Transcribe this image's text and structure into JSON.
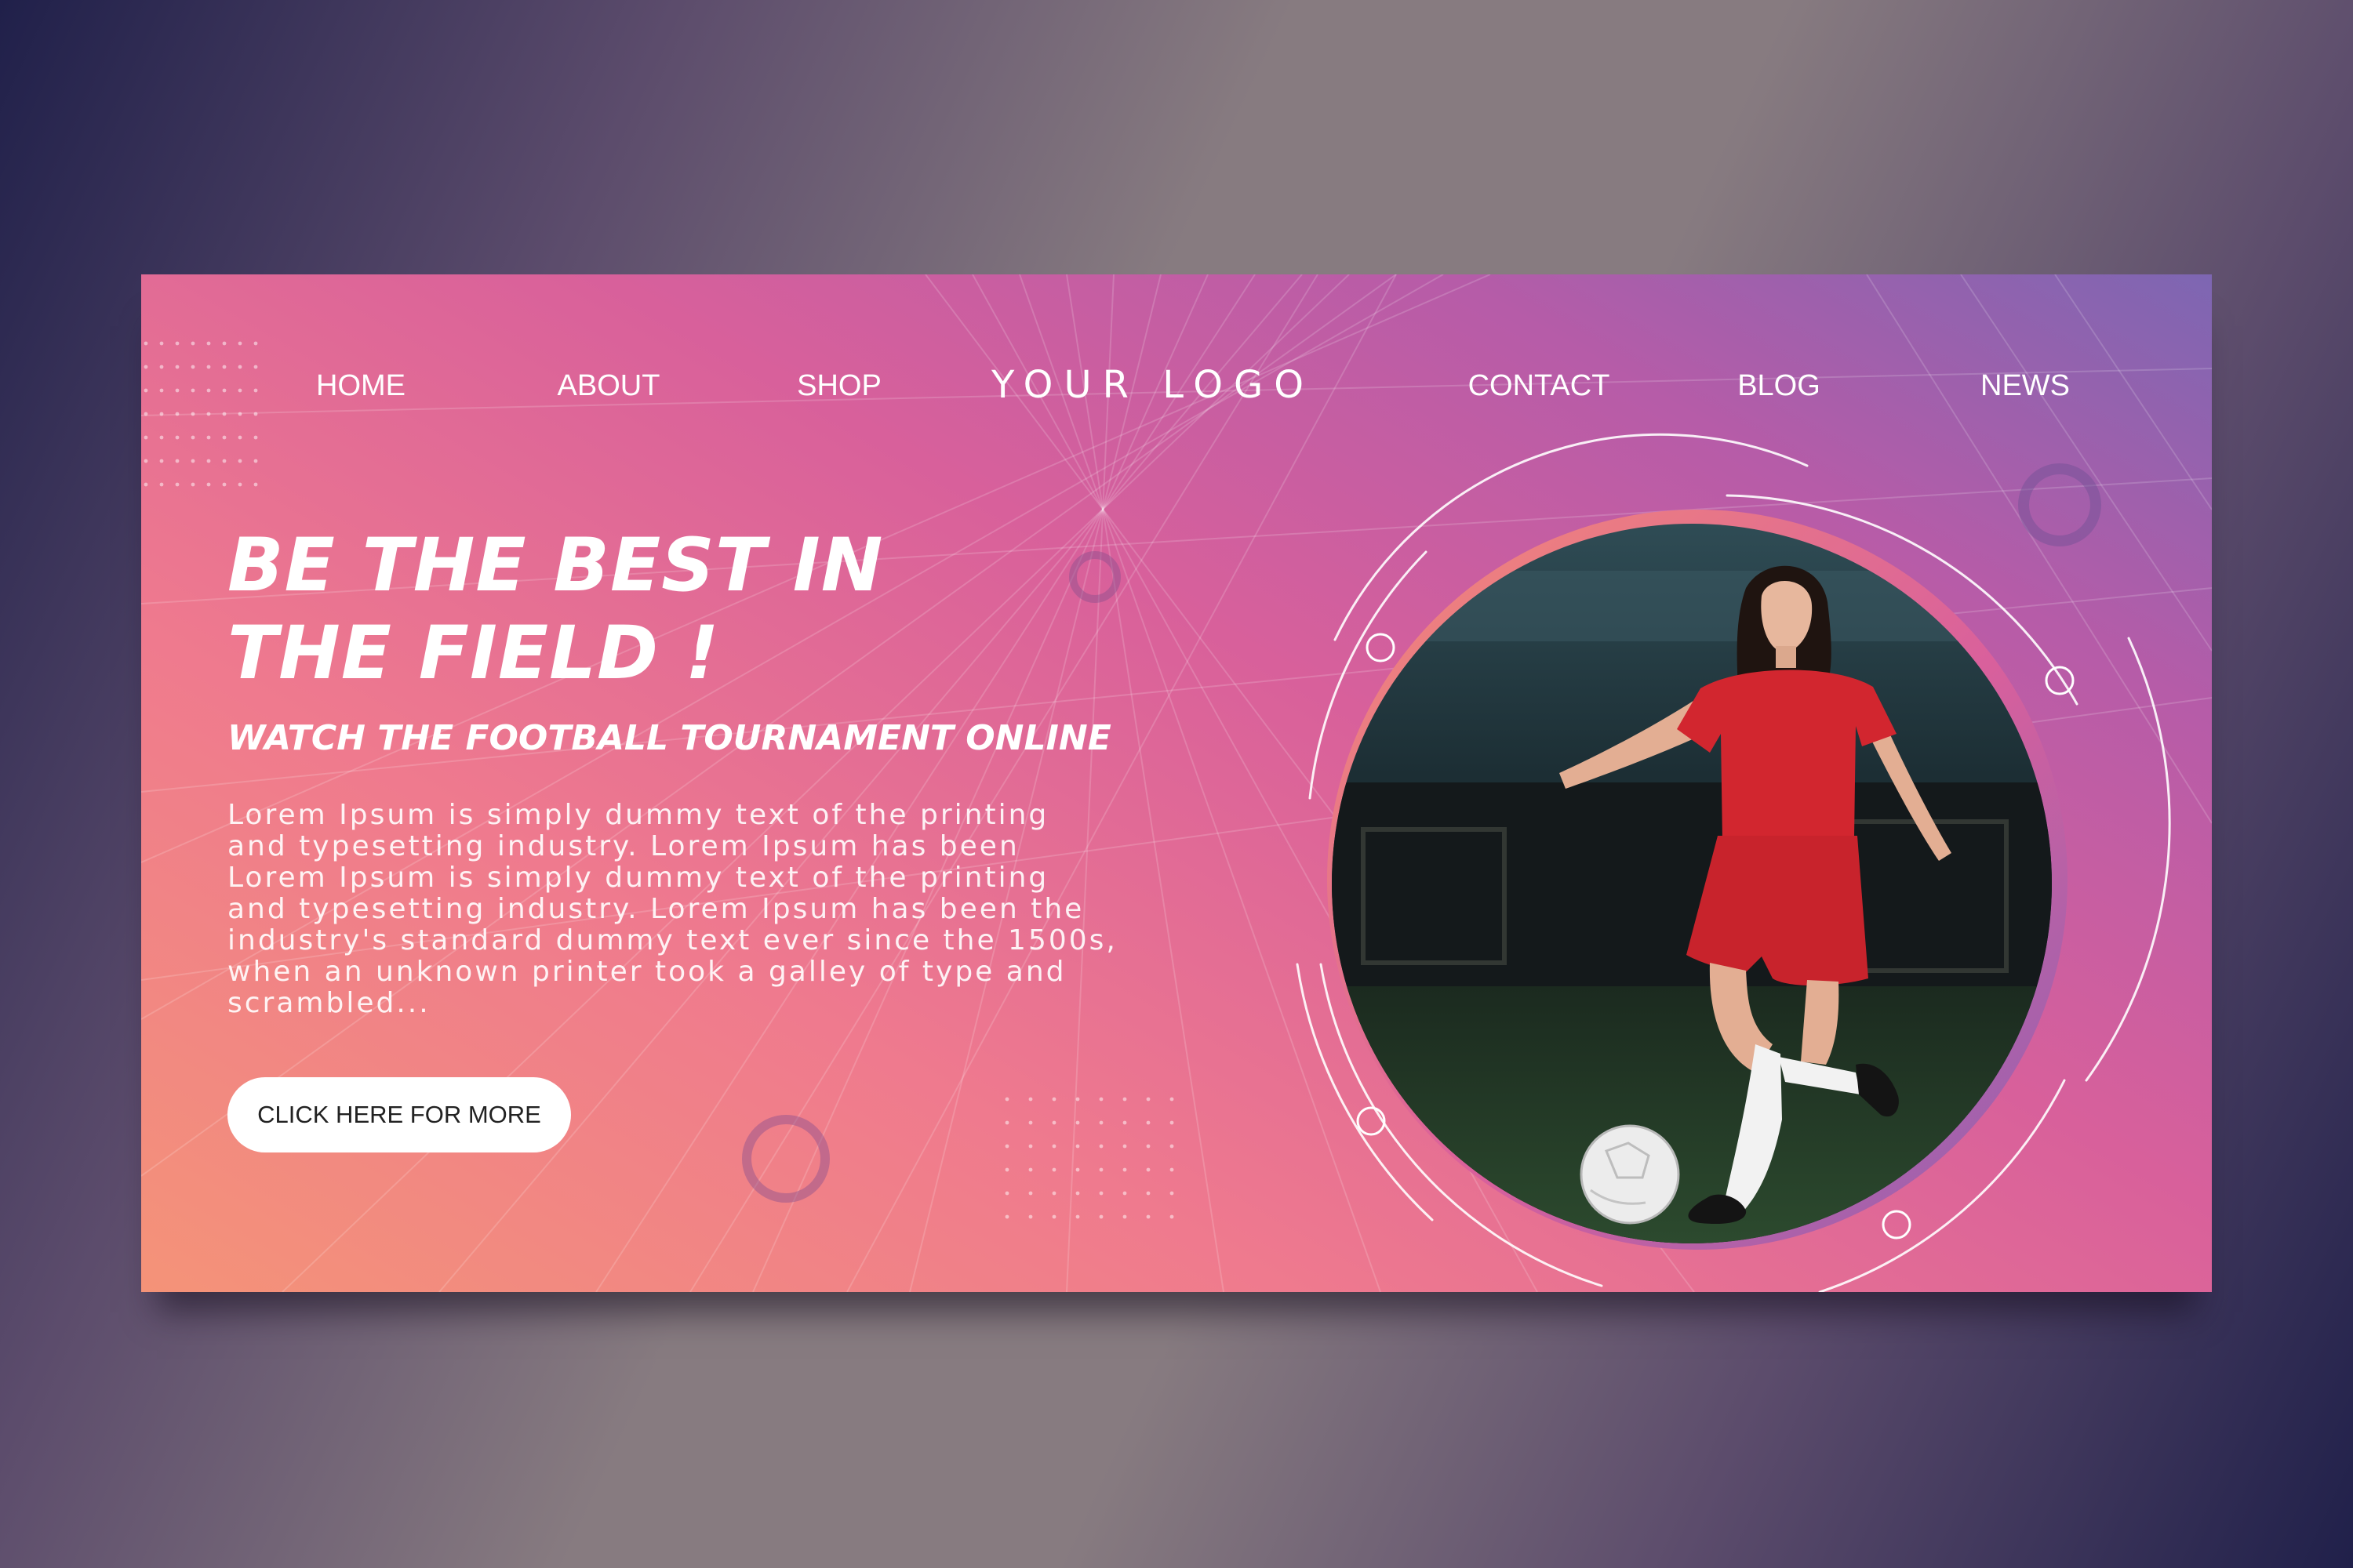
{
  "nav": {
    "left": [
      "HOME",
      "ABOUT",
      "SHOP"
    ],
    "logo": "YOUR LOGO",
    "right": [
      "CONTACT",
      "BLOG",
      "NEWS"
    ]
  },
  "hero": {
    "headline_line1": "BE THE BEST IN",
    "headline_line2": "THE FIELD !",
    "subheadline": "WATCH THE FOOTBALL TOURNAMENT ONLINE",
    "body": "Lorem Ipsum is simply dummy text of the printing\nand typesetting industry. Lorem Ipsum has been\nLorem Ipsum is simply dummy text of the printing\nand typesetting industry. Lorem Ipsum has been the\nindustry's standard dummy text ever since the 1500s,\nwhen an unknown printer took a galley of type and\nscrambled...",
    "cta_label": "CLICK HERE FOR MORE"
  },
  "colors": {
    "gradient_start": "#f49378",
    "gradient_mid": "#d8609b",
    "gradient_end": "#7d66b2",
    "text": "#ffffff",
    "button_bg": "#ffffff",
    "button_text": "#222222",
    "jersey": "#d2262f"
  },
  "photo": {
    "subject": "soccer player in red kit kicking a ball"
  }
}
